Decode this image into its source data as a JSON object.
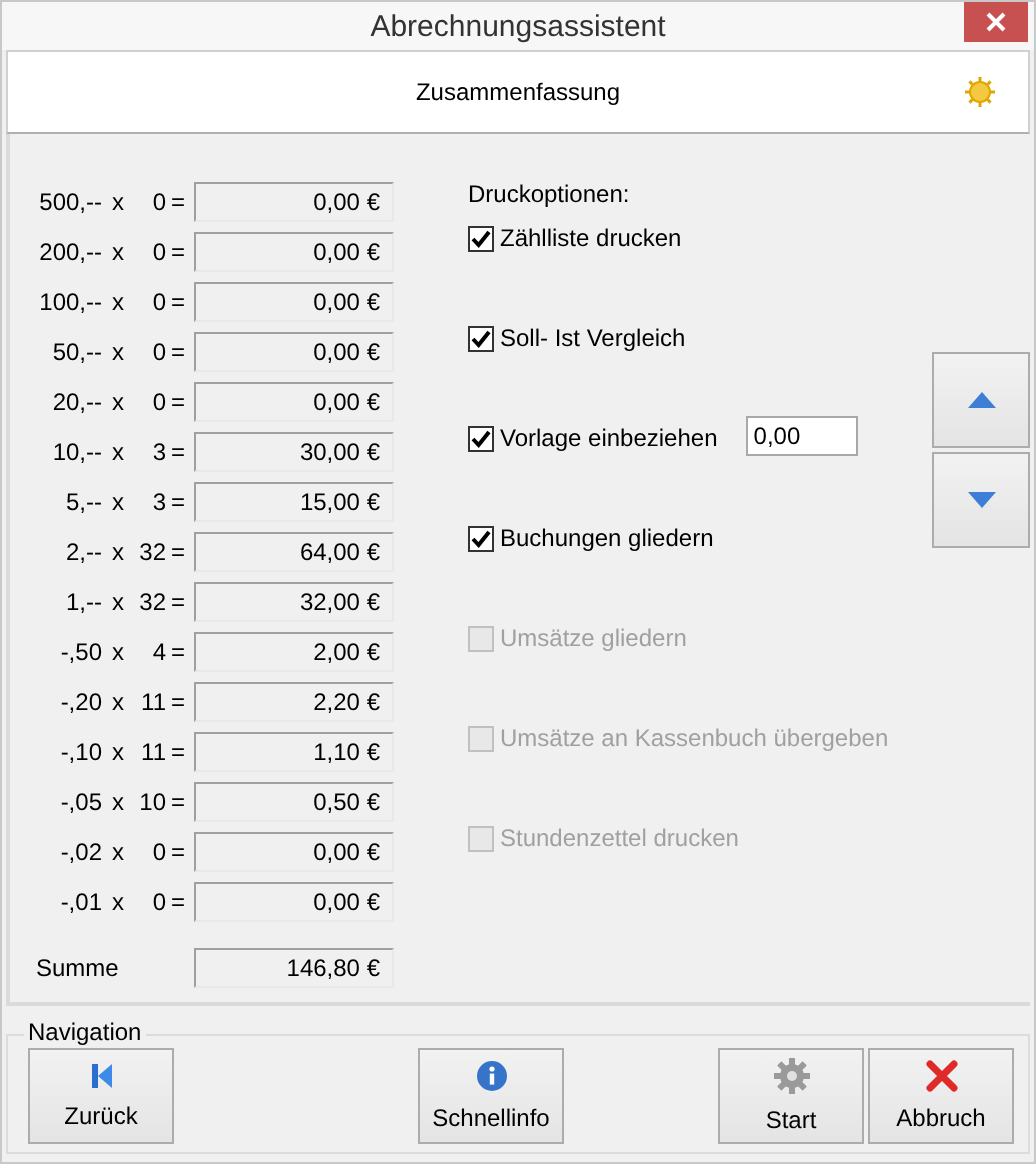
{
  "window": {
    "title": "Abrechnungsassistent"
  },
  "header": {
    "title": "Zusammenfassung"
  },
  "denominations": [
    {
      "label": "500,--",
      "times": "x",
      "count": "0",
      "equals": "=",
      "amount": "0,00 €"
    },
    {
      "label": "200,--",
      "times": "x",
      "count": "0",
      "equals": "=",
      "amount": "0,00 €"
    },
    {
      "label": "100,--",
      "times": "x",
      "count": "0",
      "equals": "=",
      "amount": "0,00 €"
    },
    {
      "label": "50,--",
      "times": "x",
      "count": "0",
      "equals": "=",
      "amount": "0,00 €"
    },
    {
      "label": "20,--",
      "times": "x",
      "count": "0",
      "equals": "=",
      "amount": "0,00 €"
    },
    {
      "label": "10,--",
      "times": "x",
      "count": "3",
      "equals": "=",
      "amount": "30,00 €"
    },
    {
      "label": "5,--",
      "times": "x",
      "count": "3",
      "equals": "=",
      "amount": "15,00 €"
    },
    {
      "label": "2,--",
      "times": "x",
      "count": "32",
      "equals": "=",
      "amount": "64,00 €"
    },
    {
      "label": "1,--",
      "times": "x",
      "count": "32",
      "equals": "=",
      "amount": "32,00 €"
    },
    {
      "label": "-,50",
      "times": "x",
      "count": "4",
      "equals": "=",
      "amount": "2,00 €"
    },
    {
      "label": "-,20",
      "times": "x",
      "count": "11",
      "equals": "=",
      "amount": "2,20 €"
    },
    {
      "label": "-,10",
      "times": "x",
      "count": "11",
      "equals": "=",
      "amount": "1,10 €"
    },
    {
      "label": "-,05",
      "times": "x",
      "count": "10",
      "equals": "=",
      "amount": "0,50 €"
    },
    {
      "label": "-,02",
      "times": "x",
      "count": "0",
      "equals": "=",
      "amount": "0,00 €"
    },
    {
      "label": "-,01",
      "times": "x",
      "count": "0",
      "equals": "=",
      "amount": "0,00 €"
    }
  ],
  "total": {
    "label": "Summe",
    "amount": "146,80 €"
  },
  "print_options": {
    "title": "Druckoptionen:",
    "options": [
      {
        "label": "Zählliste drucken",
        "checked": true,
        "disabled": false
      },
      {
        "label": "Soll- Ist Vergleich",
        "checked": true,
        "disabled": false
      },
      {
        "label": "Vorlage einbeziehen",
        "checked": true,
        "disabled": false,
        "value": "0,00"
      },
      {
        "label": "Buchungen gliedern",
        "checked": true,
        "disabled": false
      },
      {
        "label": "Umsätze gliedern",
        "checked": false,
        "disabled": true
      },
      {
        "label": "Umsätze an Kassenbuch übergeben",
        "checked": false,
        "disabled": true
      },
      {
        "label": "Stundenzettel drucken",
        "checked": false,
        "disabled": true
      }
    ]
  },
  "navigation": {
    "title": "Navigation",
    "buttons": [
      {
        "label": "Zurück",
        "kind": "back"
      },
      {
        "label": "Schnellinfo",
        "kind": "info"
      },
      {
        "label": "Start",
        "kind": "start"
      },
      {
        "label": "Abbruch",
        "kind": "cancel"
      }
    ]
  }
}
